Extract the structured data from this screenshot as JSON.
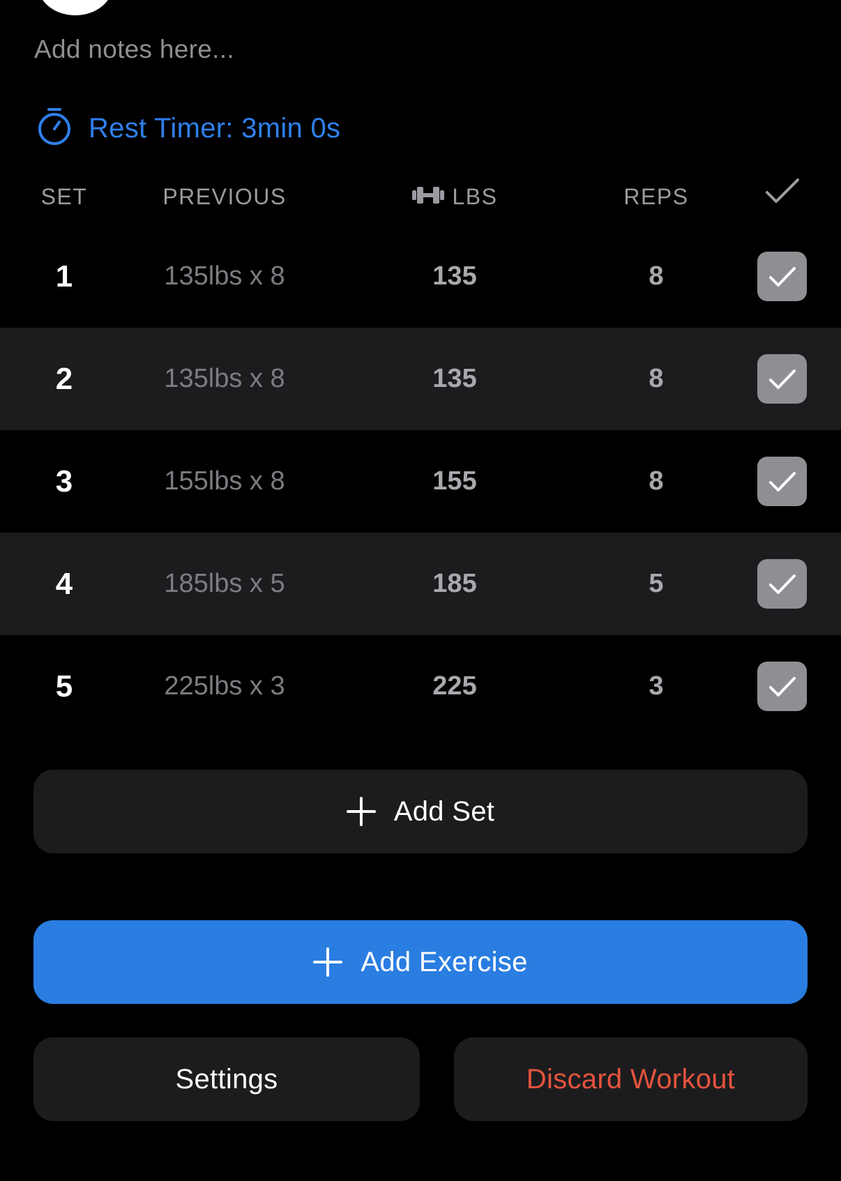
{
  "notes": {
    "placeholder": "Add notes here..."
  },
  "rest_timer": {
    "label": "Rest Timer: 3min 0s",
    "icon": "stopwatch-icon"
  },
  "table": {
    "headers": {
      "set": "SET",
      "previous": "PREVIOUS",
      "lbs": "LBS",
      "reps": "REPS",
      "lbs_icon": "dumbbell-icon",
      "check_icon": "checkmark-icon"
    },
    "rows": [
      {
        "set": "1",
        "previous": "135lbs x 8",
        "lbs": "135",
        "reps": "8",
        "completed": true
      },
      {
        "set": "2",
        "previous": "135lbs x 8",
        "lbs": "135",
        "reps": "8",
        "completed": true
      },
      {
        "set": "3",
        "previous": "155lbs x 8",
        "lbs": "155",
        "reps": "8",
        "completed": true
      },
      {
        "set": "4",
        "previous": "185lbs x 5",
        "lbs": "185",
        "reps": "5",
        "completed": true
      },
      {
        "set": "5",
        "previous": "225lbs x 3",
        "lbs": "225",
        "reps": "3",
        "completed": true
      }
    ]
  },
  "actions": {
    "add_set": "Add Set",
    "add_exercise": "Add Exercise",
    "settings": "Settings",
    "discard_workout": "Discard Workout"
  },
  "colors": {
    "accent": "#2f80ed",
    "button_primary": "#2a7de1",
    "destructive": "#e5533d",
    "row_alt": "#1c1c1e",
    "check_box": "#8e8e93"
  }
}
